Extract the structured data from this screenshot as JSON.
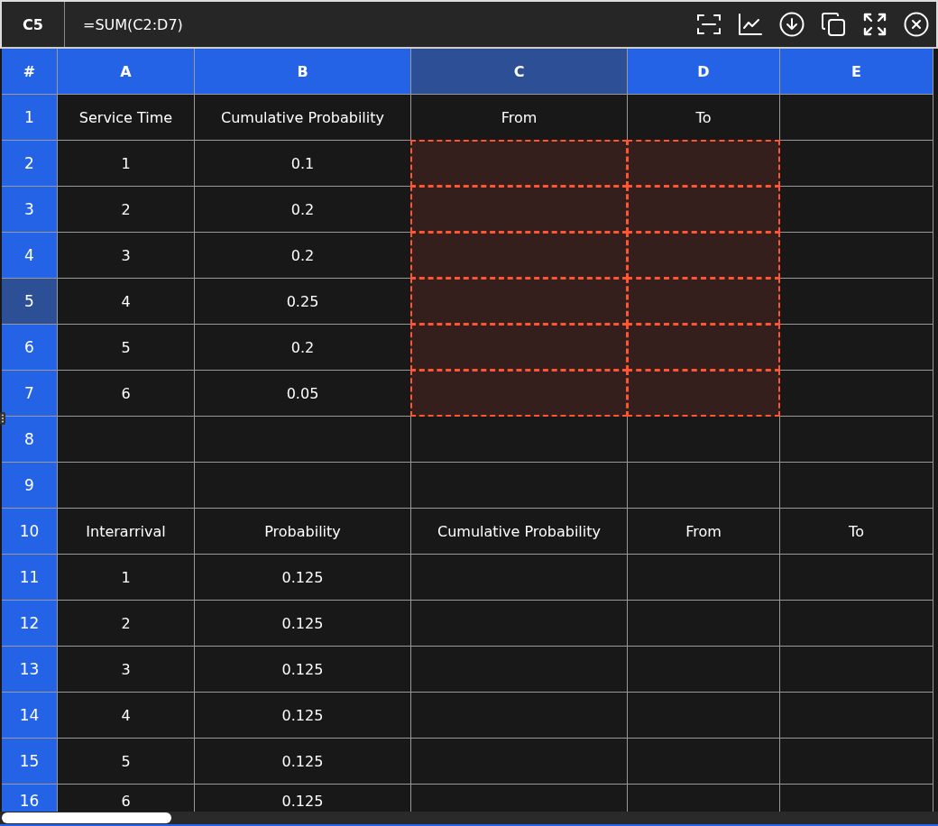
{
  "formula_bar": {
    "cell_ref": "C5",
    "formula": "=SUM(C2:D7)"
  },
  "columns": [
    {
      "label": "#",
      "selected": false
    },
    {
      "label": "A",
      "selected": false
    },
    {
      "label": "B",
      "selected": false
    },
    {
      "label": "C",
      "selected": true
    },
    {
      "label": "D",
      "selected": false
    },
    {
      "label": "E",
      "selected": false
    }
  ],
  "rows": [
    {
      "label": "1",
      "selected": false,
      "cells": [
        {
          "text": "Service Time",
          "in_range": false
        },
        {
          "text": "Cumulative Probability",
          "in_range": false
        },
        {
          "text": "From",
          "in_range": false
        },
        {
          "text": "To",
          "in_range": false
        },
        {
          "in_range": false
        }
      ]
    },
    {
      "label": "2",
      "selected": false,
      "cells": [
        {
          "text": "1",
          "in_range": false
        },
        {
          "text": "0.1",
          "in_range": false
        },
        {
          "in_range": true
        },
        {
          "in_range": true
        },
        {
          "in_range": false
        }
      ]
    },
    {
      "label": "3",
      "selected": false,
      "cells": [
        {
          "text": "2",
          "in_range": false
        },
        {
          "text": "0.2",
          "in_range": false
        },
        {
          "in_range": true
        },
        {
          "in_range": true
        },
        {
          "in_range": false
        }
      ]
    },
    {
      "label": "4",
      "selected": false,
      "cells": [
        {
          "text": "3",
          "in_range": false
        },
        {
          "text": "0.2",
          "in_range": false
        },
        {
          "in_range": true
        },
        {
          "in_range": true
        },
        {
          "in_range": false
        }
      ]
    },
    {
      "label": "5",
      "selected": true,
      "cells": [
        {
          "text": "4",
          "in_range": false
        },
        {
          "text": "0.25",
          "in_range": false
        },
        {
          "in_range": true
        },
        {
          "in_range": true
        },
        {
          "in_range": false
        }
      ]
    },
    {
      "label": "6",
      "selected": false,
      "cells": [
        {
          "text": "5",
          "in_range": false
        },
        {
          "text": "0.2",
          "in_range": false
        },
        {
          "in_range": true
        },
        {
          "in_range": true
        },
        {
          "in_range": false
        }
      ]
    },
    {
      "label": "7",
      "selected": false,
      "cells": [
        {
          "text": "6",
          "in_range": false
        },
        {
          "text": "0.05",
          "in_range": false
        },
        {
          "in_range": true
        },
        {
          "in_range": true
        },
        {
          "in_range": false
        }
      ]
    },
    {
      "label": "8",
      "selected": false,
      "cells": [
        {
          "in_range": false
        },
        {
          "in_range": false
        },
        {
          "in_range": false
        },
        {
          "in_range": false
        },
        {
          "in_range": false
        }
      ]
    },
    {
      "label": "9",
      "selected": false,
      "cells": [
        {
          "in_range": false
        },
        {
          "in_range": false
        },
        {
          "in_range": false
        },
        {
          "in_range": false
        },
        {
          "in_range": false
        }
      ]
    },
    {
      "label": "10",
      "selected": false,
      "cells": [
        {
          "text": "Interarrival",
          "in_range": false
        },
        {
          "text": "Probability",
          "in_range": false
        },
        {
          "text": "Cumulative Probability",
          "in_range": false
        },
        {
          "text": "From",
          "in_range": false
        },
        {
          "text": "To",
          "in_range": false
        }
      ]
    },
    {
      "label": "11",
      "selected": false,
      "cells": [
        {
          "text": "1",
          "in_range": false
        },
        {
          "text": "0.125",
          "in_range": false
        },
        {
          "in_range": false
        },
        {
          "in_range": false
        },
        {
          "in_range": false
        }
      ]
    },
    {
      "label": "12",
      "selected": false,
      "cells": [
        {
          "text": "2",
          "in_range": false
        },
        {
          "text": "0.125",
          "in_range": false
        },
        {
          "in_range": false
        },
        {
          "in_range": false
        },
        {
          "in_range": false
        }
      ]
    },
    {
      "label": "13",
      "selected": false,
      "cells": [
        {
          "text": "3",
          "in_range": false
        },
        {
          "text": "0.125",
          "in_range": false
        },
        {
          "in_range": false
        },
        {
          "in_range": false
        },
        {
          "in_range": false
        }
      ]
    },
    {
      "label": "14",
      "selected": false,
      "cells": [
        {
          "text": "4",
          "in_range": false
        },
        {
          "text": "0.125",
          "in_range": false
        },
        {
          "in_range": false
        },
        {
          "in_range": false
        },
        {
          "in_range": false
        }
      ]
    },
    {
      "label": "15",
      "selected": false,
      "cells": [
        {
          "text": "5",
          "in_range": false
        },
        {
          "text": "0.125",
          "in_range": false
        },
        {
          "in_range": false
        },
        {
          "in_range": false
        },
        {
          "in_range": false
        }
      ]
    },
    {
      "label": "16",
      "selected": false,
      "cells": [
        {
          "text": "6",
          "in_range": false
        },
        {
          "text": "0.125",
          "in_range": false
        },
        {
          "in_range": false
        },
        {
          "in_range": false
        },
        {
          "in_range": false
        }
      ]
    }
  ]
}
